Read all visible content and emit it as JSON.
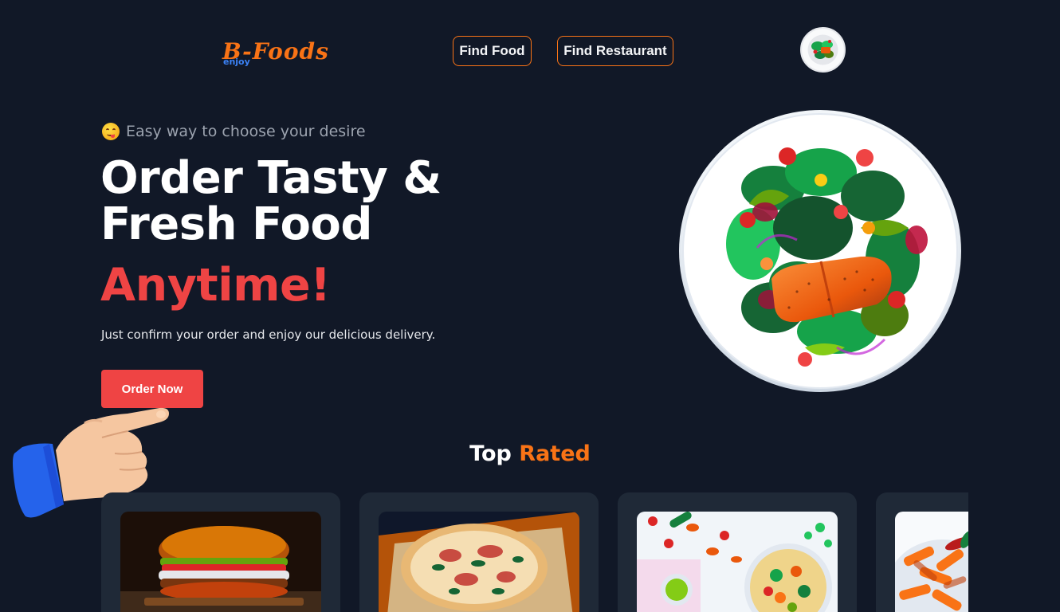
{
  "header": {
    "logo_text": "B-Foods",
    "logo_subtext": "enjoy",
    "nav": [
      {
        "label": "Find Food"
      },
      {
        "label": "Find Restaurant"
      }
    ],
    "avatar_icon": "salad-avatar-icon"
  },
  "hero": {
    "tagline_icon": "yum-face-emoji",
    "tagline": "Easy way to choose your desire",
    "headline": "Order Tasty & Fresh Food",
    "headline_accent": "Anytime!",
    "description": "Just confirm your order and enjoy our delicious delivery.",
    "cta_label": "Order Now",
    "image": "salmon-salad-plate"
  },
  "top_rated": {
    "title_part1": "Top",
    "title_part2": "Rated",
    "cards": [
      {
        "image": "burger-photo"
      },
      {
        "image": "pizza-photo"
      },
      {
        "image": "vegetable-bowl-photo"
      },
      {
        "image": "penne-pasta-photo"
      }
    ]
  },
  "colors": {
    "background": "#111827",
    "card": "#1f2937",
    "accent_red": "#ef4444",
    "accent_orange": "#f97316",
    "logo_sub_blue": "#3b82f6"
  }
}
